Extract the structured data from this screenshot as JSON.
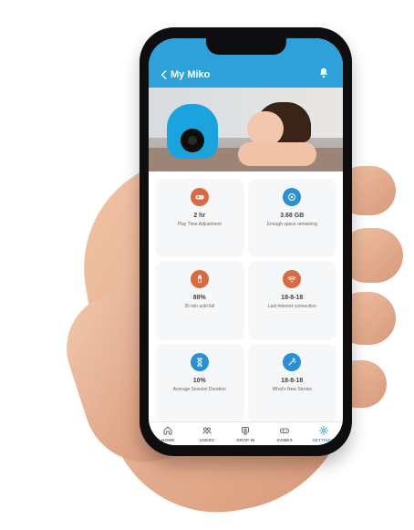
{
  "app": {
    "title": "My Miko"
  },
  "tiles": [
    {
      "value": "2 hr",
      "label": "Play Time Adjustment",
      "icon": "gamepad-icon",
      "color": "#d96b43"
    },
    {
      "value": "3.68 GB",
      "label": "Enough space remaining",
      "icon": "storage-icon",
      "color": "#2b8fd1"
    },
    {
      "value": "88%",
      "label": "30 min until full",
      "icon": "battery-icon",
      "color": "#d96b43"
    },
    {
      "value": "18-8-18",
      "label": "Last internet connection",
      "icon": "wifi-icon",
      "color": "#d96b43"
    },
    {
      "value": "10%",
      "label": "Average Session Duration",
      "icon": "hourglass-icon",
      "color": "#2b8fd1"
    },
    {
      "value": "18-8-18",
      "label": "What's New Stories",
      "icon": "sparkle-icon",
      "color": "#2b8fd1"
    }
  ],
  "tabs": [
    {
      "label": "HOME",
      "icon": "home-icon",
      "active": false
    },
    {
      "label": "USERS",
      "icon": "users-icon",
      "active": false
    },
    {
      "label": "DROP IN",
      "icon": "drop-in-icon",
      "active": false
    },
    {
      "label": "GAMES",
      "icon": "games-icon",
      "active": false
    },
    {
      "label": "SETTINGS",
      "icon": "settings-icon",
      "active": true
    }
  ],
  "colors": {
    "primary": "#2ea0da",
    "orange": "#d96b43",
    "blue": "#2b8fd1"
  }
}
